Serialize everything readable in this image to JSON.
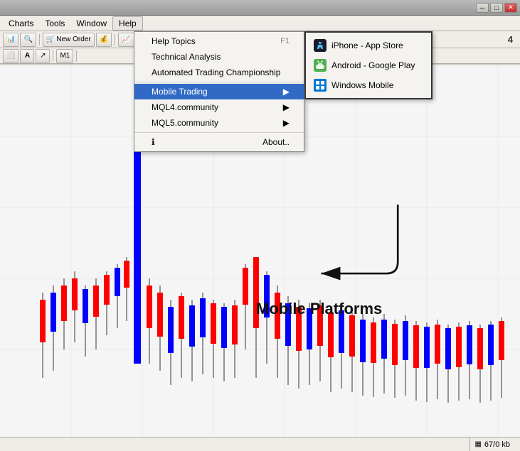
{
  "titlebar": {
    "text": ""
  },
  "menubar": {
    "items": [
      "Charts",
      "Tools",
      "Window",
      "Help"
    ]
  },
  "toolbar1": {
    "new_order": "New Order"
  },
  "dropdown": {
    "items": [
      {
        "label": "Help Topics",
        "shortcut": "F1",
        "icon": "",
        "submenu": false
      },
      {
        "label": "Technical Analysis",
        "shortcut": "",
        "icon": "",
        "submenu": false
      },
      {
        "label": "Automated Trading Championship",
        "shortcut": "",
        "icon": "",
        "submenu": false
      },
      {
        "label": "Mobile Trading",
        "shortcut": "",
        "icon": "",
        "submenu": true,
        "active": true
      },
      {
        "label": "MQL4.community",
        "shortcut": "",
        "icon": "",
        "submenu": true
      },
      {
        "label": "MQL5.community",
        "shortcut": "",
        "icon": "",
        "submenu": true
      },
      {
        "label": "About..",
        "shortcut": "",
        "icon": "about",
        "submenu": false
      }
    ]
  },
  "submenu": {
    "items": [
      {
        "label": "iPhone - App Store",
        "icon": "apple"
      },
      {
        "label": "Android - Google Play",
        "icon": "android"
      },
      {
        "label": "Windows Mobile",
        "icon": "windows"
      }
    ]
  },
  "annotation": {
    "text": "Mobile Platforms"
  },
  "statusbar": {
    "left": "",
    "right": "67/0 kb"
  }
}
